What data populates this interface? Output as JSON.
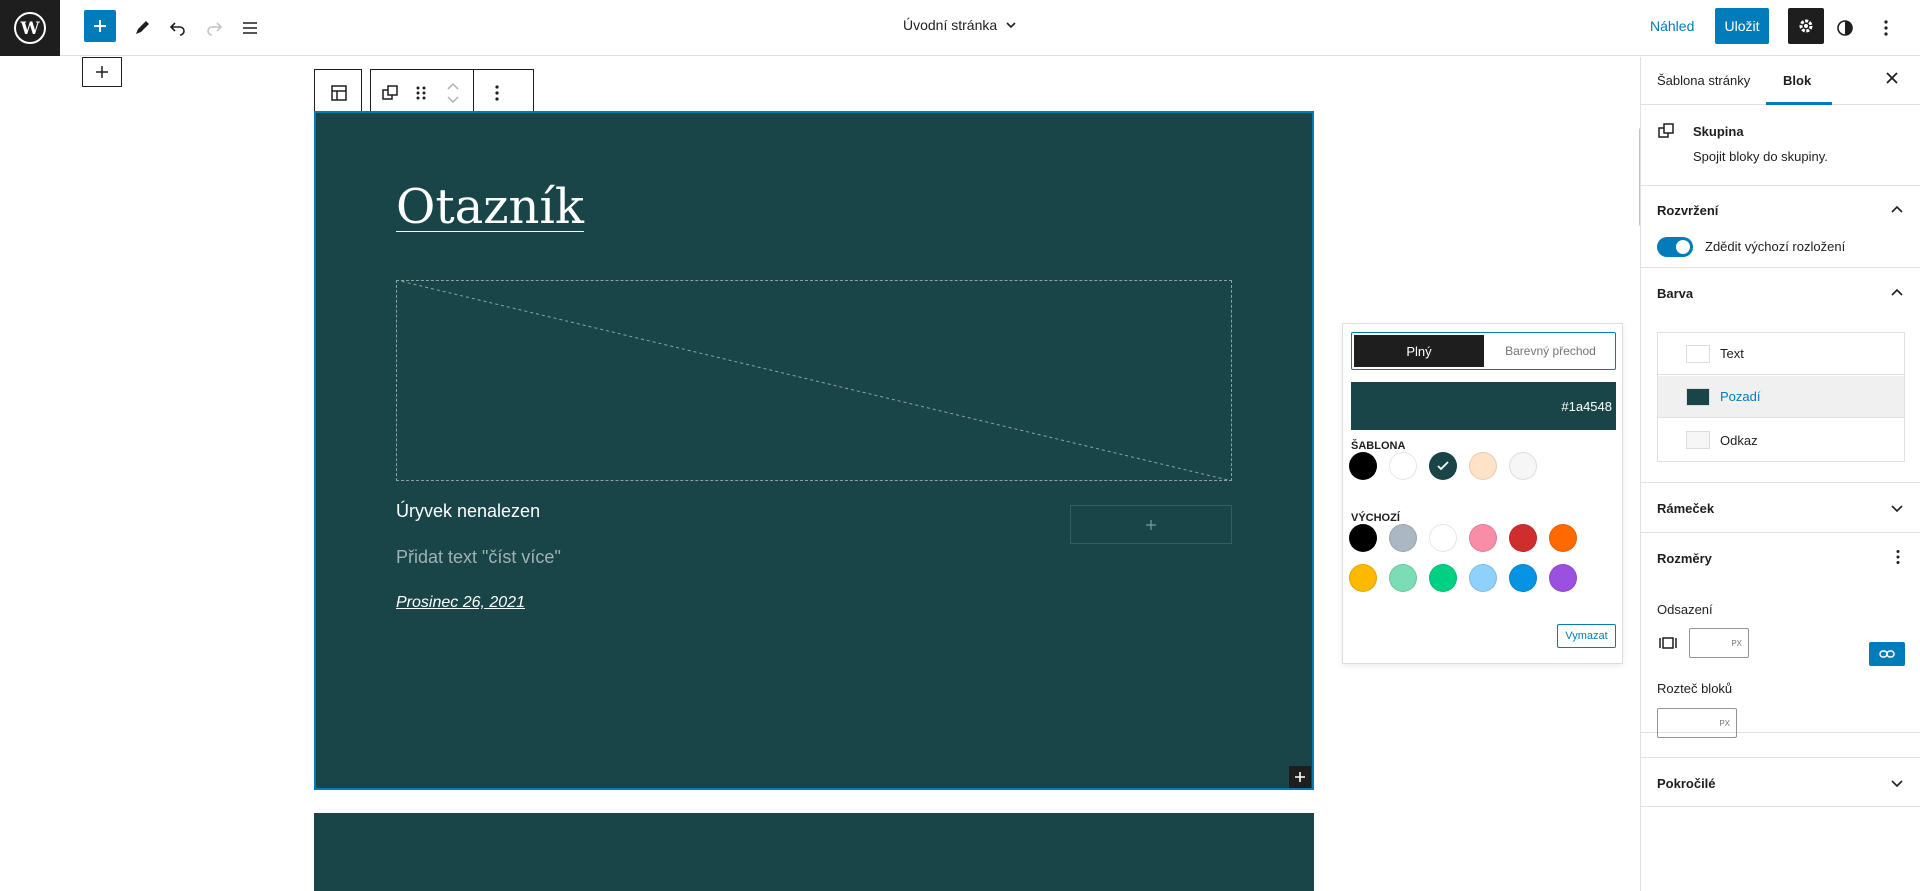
{
  "header": {
    "document_title": "Úvodní stránka",
    "preview_label": "Náhled",
    "save_label": "Uložit"
  },
  "canvas": {
    "block_title": "Otazník",
    "excerpt_text": "Úryvek nenalezen",
    "read_more_placeholder": "Přidat text \"číst více\"",
    "post_date": "Prosinec 26, 2021"
  },
  "color_popover": {
    "tab_solid": "Plný",
    "tab_gradient": "Barevný přechod",
    "current_hex": "#1a4548",
    "theme_heading": "Šablona",
    "default_heading": "Výchozí",
    "clear_label": "Vymazat",
    "theme_colors": [
      "#000000",
      "#ffffff",
      "#1a4548",
      "#ffe2c7",
      "#f6f6f6"
    ],
    "default_colors": [
      "#000000",
      "#abb8c3",
      "#ffffff",
      "#f78da7",
      "#cf2e2e",
      "#ff6900",
      "#fcb900",
      "#7bdcb5",
      "#00d084",
      "#8ed1fc",
      "#0693e3",
      "#9b51e0"
    ],
    "selected_color": "#1a4548"
  },
  "sidebar": {
    "tab_template": "Šablona stránky",
    "tab_block": "Blok",
    "block_name": "Skupina",
    "block_description": "Spojit bloky do skupiny.",
    "layout_heading": "Rozvržení",
    "layout_toggle_label": "Zdědit výchozí rozložení",
    "color_heading": "Barva",
    "color_items": [
      {
        "label": "Text",
        "chip": "#ffffff"
      },
      {
        "label": "Pozadí",
        "chip": "#1a4548"
      },
      {
        "label": "Odkaz",
        "chip": "#f6f6f6"
      }
    ],
    "border_heading": "Rámeček",
    "dimensions_heading": "Rozměry",
    "padding_label": "Odsazení",
    "padding_unit": "PX",
    "block_spacing_label": "Rozteč bloků",
    "block_spacing_unit": "PX",
    "advanced_heading": "Pokročilé"
  },
  "colors": {
    "accent": "#007cba",
    "block_background": "#1a4548",
    "dark": "#1e1e1e"
  }
}
